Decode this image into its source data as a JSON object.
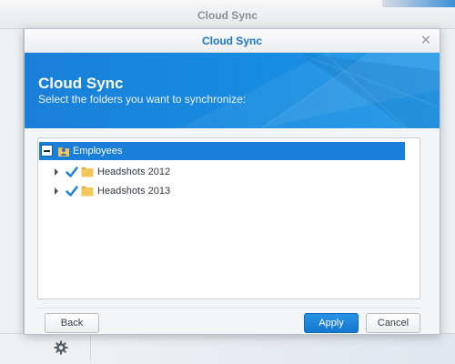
{
  "background": {
    "window_title": "Cloud Sync",
    "settings_icon": "gear-icon"
  },
  "dialog": {
    "title": "Cloud Sync",
    "close_icon": "close-icon",
    "banner_title": "Cloud Sync",
    "banner_subtitle": "Select the folders you want to synchronize:",
    "accent_color": "#1a7fd8",
    "tree": {
      "root": {
        "label": "Employees",
        "icon": "shared-folder-icon",
        "expanded": true,
        "selected": true
      },
      "children": [
        {
          "label": "Headshots 2012",
          "checked": true,
          "icon": "folder-icon"
        },
        {
          "label": "Headshots 2013",
          "checked": true,
          "icon": "folder-icon"
        }
      ]
    },
    "buttons": {
      "back": "Back",
      "apply": "Apply",
      "cancel": "Cancel"
    }
  }
}
